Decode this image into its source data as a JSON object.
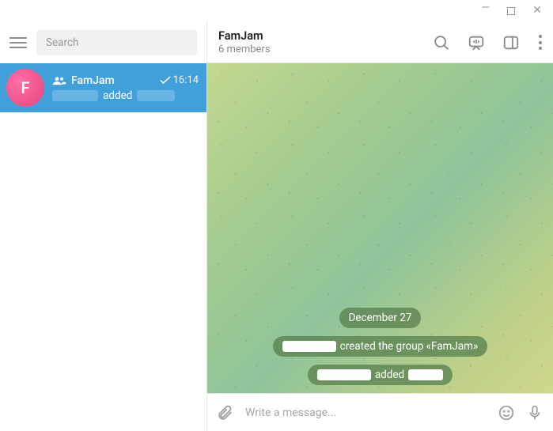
{
  "search": {
    "placeholder": "Search"
  },
  "chat": {
    "avatar_letter": "F",
    "name": "FamJam",
    "time": "16:14",
    "added_word": "added"
  },
  "header": {
    "title": "FamJam",
    "subtitle": "6 members"
  },
  "messages": {
    "date": "December 27",
    "created_text": "created the group «FamJam»",
    "added_text": "added"
  },
  "composer": {
    "placeholder": "Write a message..."
  }
}
